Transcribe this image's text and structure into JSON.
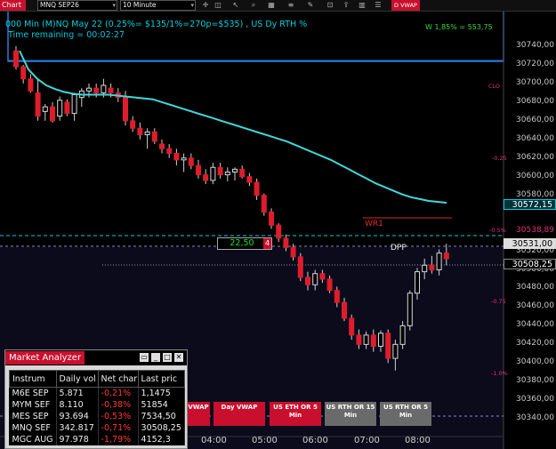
{
  "toolbar": {
    "chart_tab": "Chart",
    "instrument": "MNQ SEP26",
    "interval": "10 Minute",
    "icons": [
      "crosshair-icon",
      "lock-icon",
      "cursor-icon",
      "zoom-icon",
      "grid-icon",
      "text-icon",
      "draw-icon",
      "camera-icon",
      "share-icon",
      "bars-icon",
      "properties-icon"
    ],
    "indicator_badge": "D VWAP"
  },
  "chart": {
    "info_line1": "000 Min (M)NQ May 22 (0.25%= $135/1%=270p=$535) , US Dy RTH %",
    "info_line2": "Time remaining = 00:02:27",
    "pnl": "W 1,85% = 553,75",
    "price_labels": [
      "30740,00",
      "30720,00",
      "30700,00",
      "30680,00",
      "30660,00",
      "30640,00",
      "30620,00",
      "30600,00",
      "30580,00",
      "30520,00",
      "30500,00",
      "30480,00",
      "30460,00",
      "30440,00",
      "30420,00",
      "30400,00",
      "30380,00",
      "30360,00",
      "30340,00"
    ],
    "price_tags": {
      "vwap": "30572,15",
      "dpp": "30531,00",
      "last": "30508,25",
      "upper": "30538,89"
    },
    "pct_labels": {
      "clo": "CLO",
      "m025": "-0.25",
      "m05": "-0.5%",
      "m075": "-0.75",
      "m1": "-1.0%"
    },
    "wr1_label": "WR1",
    "dpp_label": "DPP",
    "order": {
      "quantity": "22,50",
      "count": "4"
    },
    "times": [
      "04:00",
      "05:00",
      "06:00",
      "07:00",
      "08:00"
    ],
    "vwap_buttons": [
      "VWAP",
      "Day VWAP",
      "US ETH OR 5 Min",
      "US RTH OR 15 Min",
      "US RTH OR 5 Min"
    ]
  },
  "market_analyzer": {
    "title": "Market Analyzer",
    "columns": [
      "Instrum",
      "Daily vol",
      "Net char",
      "Last pric"
    ],
    "rows": [
      {
        "instrument": "M6E SEP",
        "volume": "5.871",
        "change": "-0,21%",
        "last": "1,1475"
      },
      {
        "instrument": "MYM SEF",
        "volume": "8.110",
        "change": "-0,38%",
        "last": "51854"
      },
      {
        "instrument": "MES SEP",
        "volume": "93.694",
        "change": "-0,53%",
        "last": "7534,50"
      },
      {
        "instrument": "MNQ SEF",
        "volume": "342.817",
        "change": "-0,71%",
        "last": "30508,25"
      },
      {
        "instrument": "MGC AUG",
        "volume": "97.978",
        "change": "-1,79%",
        "last": "4152,3"
      }
    ]
  },
  "chart_data": {
    "type": "candlestick",
    "candles": [
      [
        30735,
        30740,
        30715,
        30718
      ],
      [
        30718,
        30720,
        30700,
        30705
      ],
      [
        30705,
        30710,
        30690,
        30692
      ],
      [
        30690,
        30705,
        30660,
        30665
      ],
      [
        30670,
        30678,
        30660,
        30675
      ],
      [
        30675,
        30680,
        30658,
        30660
      ],
      [
        30665,
        30686,
        30660,
        30682
      ],
      [
        30680,
        30683,
        30665,
        30668
      ],
      [
        30668,
        30690,
        30660,
        30688
      ],
      [
        30685,
        30695,
        30675,
        30692
      ],
      [
        30692,
        30700,
        30685,
        30695
      ],
      [
        30695,
        30700,
        30685,
        30690
      ],
      [
        30690,
        30705,
        30685,
        30698
      ],
      [
        30695,
        30700,
        30685,
        30690
      ],
      [
        30690,
        30695,
        30680,
        30685
      ],
      [
        30685,
        30692,
        30655,
        30660
      ],
      [
        30660,
        30665,
        30648,
        30652
      ],
      [
        30652,
        30658,
        30640,
        30645
      ],
      [
        30645,
        30652,
        30630,
        30648
      ],
      [
        30648,
        30652,
        30635,
        30638
      ],
      [
        30635,
        30640,
        30625,
        30630
      ],
      [
        30630,
        30635,
        30620,
        30625
      ],
      [
        30625,
        30630,
        30612,
        30618
      ],
      [
        30618,
        30625,
        30605,
        30620
      ],
      [
        30620,
        30625,
        30608,
        30612
      ],
      [
        30612,
        30618,
        30598,
        30602
      ],
      [
        30602,
        30608,
        30592,
        30596
      ],
      [
        30596,
        30615,
        30592,
        30610
      ],
      [
        30610,
        30615,
        30598,
        30602
      ],
      [
        30602,
        30610,
        30595,
        30605
      ],
      [
        30605,
        30610,
        30596,
        30608
      ],
      [
        30608,
        30612,
        30598,
        30600
      ],
      [
        30600,
        30604,
        30590,
        30594
      ],
      [
        30594,
        30598,
        30575,
        30580
      ],
      [
        30580,
        30582,
        30558,
        30562
      ],
      [
        30562,
        30566,
        30544,
        30548
      ],
      [
        30548,
        30550,
        30530,
        30534
      ],
      [
        30534,
        30538,
        30520,
        30524
      ],
      [
        30524,
        30528,
        30510,
        30514
      ],
      [
        30514,
        30518,
        30488,
        30492
      ],
      [
        30492,
        30498,
        30478,
        30484
      ],
      [
        30484,
        30500,
        30478,
        30496
      ],
      [
        30496,
        30500,
        30486,
        30490
      ],
      [
        30490,
        30494,
        30475,
        30478
      ],
      [
        30478,
        30482,
        30460,
        30465
      ],
      [
        30465,
        30470,
        30445,
        30448
      ],
      [
        30448,
        30452,
        30425,
        30430
      ],
      [
        30430,
        30436,
        30415,
        30420
      ],
      [
        30420,
        30434,
        30415,
        30430
      ],
      [
        30430,
        30436,
        30412,
        30418
      ],
      [
        30418,
        30435,
        30412,
        30432
      ],
      [
        30432,
        30436,
        30400,
        30405
      ],
      [
        30405,
        30425,
        30392,
        30420
      ],
      [
        30420,
        30445,
        30415,
        30440
      ],
      [
        30440,
        30478,
        30435,
        30475
      ],
      [
        30475,
        30502,
        30468,
        30498
      ],
      [
        30498,
        30512,
        30490,
        30505
      ],
      [
        30505,
        30515,
        30496,
        30500
      ],
      [
        30500,
        30522,
        30494,
        30518
      ],
      [
        30518,
        30528,
        30505,
        30512
      ]
    ],
    "vwap": [
      30735,
      30715,
      30705,
      30698,
      30694,
      30691,
      30689,
      30688,
      30688,
      30688,
      30688,
      30687,
      30686,
      30685,
      30684,
      30683,
      30680,
      30677,
      30674,
      30671,
      30668,
      30665,
      30662,
      30659,
      30656,
      30653,
      30650,
      30647,
      30644,
      30641,
      30638,
      30634,
      30630,
      30626,
      30622,
      30618,
      30613,
      30608,
      30603,
      30598,
      30593,
      30589,
      30585,
      30581,
      30578,
      30576,
      30574,
      30573,
      30572
    ],
    "levels": {
      "wr1": 30545,
      "dpp": 30531,
      "last": 30508.25
    }
  }
}
